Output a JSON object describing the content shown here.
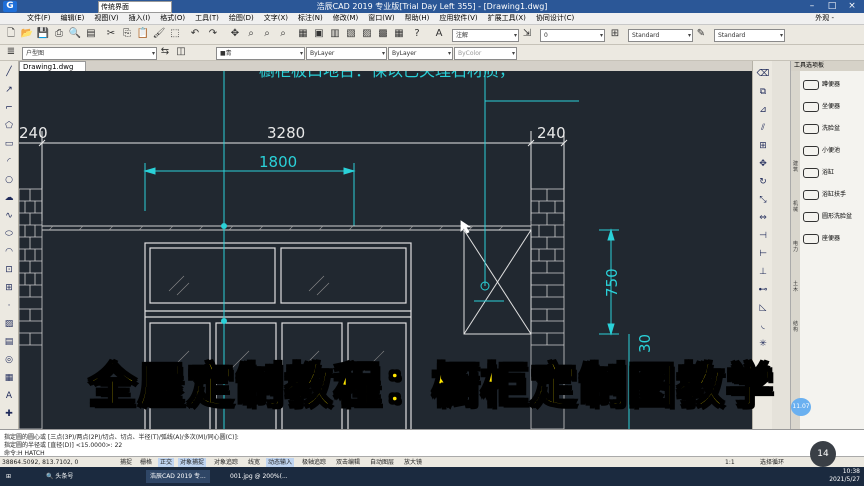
{
  "window": {
    "title": "浩辰CAD 2019 专业版[Trial Day Left 355] - [Drawing1.dwg]",
    "workspace": "传统界面",
    "logo": "G"
  },
  "menu": {
    "items": [
      "文件(F)",
      "编辑(E)",
      "视图(V)",
      "插入(I)",
      "格式(O)",
      "工具(T)",
      "绘图(D)",
      "文字(X)",
      "标注(N)",
      "修改(M)",
      "窗口(W)",
      "帮助(H)",
      "应用软件(V)",
      "扩展工具(X)",
      "协同设计(C)"
    ],
    "right": "外观 -"
  },
  "toolbar": {
    "annotation_scale": "注解",
    "dimstyle_value": "Standard",
    "textstyle_value": "Standard",
    "layer_value": "0",
    "color_value": "■青",
    "linetype_value": "ByLayer",
    "lineweight_value": "ByLayer",
    "plotstyle_value": "ByColor",
    "layer_state": "户型图"
  },
  "document": {
    "tab_label": "Drawing1.dwg"
  },
  "drawing": {
    "top_text": "橱柜板口地台：保以已关理石材质，",
    "dims": [
      "240",
      "3280",
      "240",
      "1800",
      "750",
      "30"
    ]
  },
  "palette": {
    "title": "工具选项板",
    "tabs": [
      "建筑",
      "机械",
      "电力",
      "土木",
      "结构"
    ],
    "items": [
      "蹲便器",
      "坐便器",
      "洗脸盆",
      "小便池",
      "浴缸",
      "浴缸扶手",
      "圆形洗脸盆",
      "座便器"
    ]
  },
  "command": {
    "lines": [
      "指定圆的圆心或 [三点(3P)/两点(2P)/切点、切点、半径(T)/弧线(A)/多次(M)/同心圆(C)]:",
      "指定圆的半径或 [直径(D)] <15.0000>: 22",
      "命令:H HATCH"
    ]
  },
  "status": {
    "coords": "38864.5092, 813.7102, 0",
    "buttons": [
      "捕捉",
      "栅格",
      "正交",
      "对象捕捉",
      "对象追踪",
      "线宽",
      "动态输入",
      "极轴追踪",
      "双击编辑",
      "自动图层",
      "放大镜"
    ],
    "on_buttons": [
      "正交",
      "对象捕捉",
      "动态输入"
    ],
    "scale": "1:1",
    "select": "选择循环"
  },
  "taskbar": {
    "search": "头条号",
    "items": [
      "浩辰CAD 2019 专...",
      "001.jpg @ 200%(..."
    ],
    "time": "10:38",
    "date": "2021/5/27"
  },
  "overlay": {
    "caption": "全屋定制教程：橱柜定制图教学",
    "badge": "11.07",
    "bubble": "14"
  }
}
